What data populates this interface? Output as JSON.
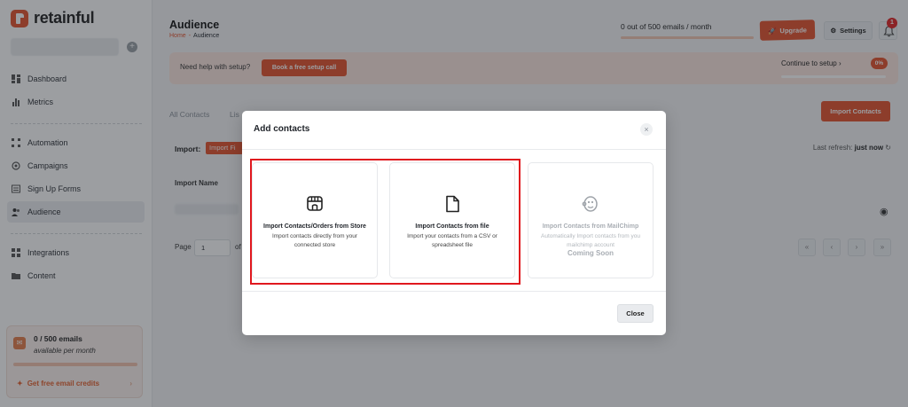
{
  "app": {
    "brand": "retainful",
    "accent": "#e4532e"
  },
  "sidebar": {
    "items": [
      {
        "label": "Dashboard",
        "icon": "dashboard-icon"
      },
      {
        "label": "Metrics",
        "icon": "bar-chart-icon"
      },
      {
        "label": "Automation",
        "icon": "automation-icon"
      },
      {
        "label": "Campaigns",
        "icon": "campaign-icon"
      },
      {
        "label": "Sign Up Forms",
        "icon": "form-icon"
      },
      {
        "label": "Audience",
        "icon": "users-icon",
        "active": true
      },
      {
        "label": "Integrations",
        "icon": "grid-icon"
      },
      {
        "label": "Content",
        "icon": "folder-icon"
      }
    ],
    "credits": {
      "count": "0 / 500 emails",
      "subtitle": "available per month",
      "link": "Get free email credits"
    }
  },
  "header": {
    "title": "Audience",
    "breadcrumb": {
      "home": "Home",
      "sep": "-",
      "current": "Audience"
    },
    "usage": "0 out of 500 emails / month",
    "upgrade": "Upgrade",
    "settings": "Settings",
    "notifications": "1"
  },
  "help": {
    "text": "Need help with setup?",
    "button": "Book a free setup call",
    "setup": "Continue to setup",
    "setup_arrow": "›",
    "percent": "0%"
  },
  "page": {
    "tabs": [
      "All Contacts",
      "Lis"
    ],
    "import_button": "Import Contacts",
    "import_label": "Import:",
    "import_filter": "Import Fi",
    "refresh_label": "Last refresh:",
    "refresh_value": "just now",
    "column_header": "Import Name",
    "pagination": {
      "label": "Page",
      "value": "1",
      "of": "of"
    }
  },
  "modal": {
    "title": "Add contacts",
    "cards": [
      {
        "title": "Import Contacts/Orders from Store",
        "desc": "Import contacts directly from your connected store",
        "icon": "store-icon"
      },
      {
        "title": "Import Contacts from file",
        "desc": "Import your contacts from a CSV or spreadsheet file",
        "icon": "file-icon"
      },
      {
        "title": "Import Contacts from MailChimp",
        "desc": "Automatically Import contacts from you mailchimp account",
        "icon": "mailchimp-icon",
        "status": "Coming Soon"
      }
    ],
    "close": "Close"
  }
}
